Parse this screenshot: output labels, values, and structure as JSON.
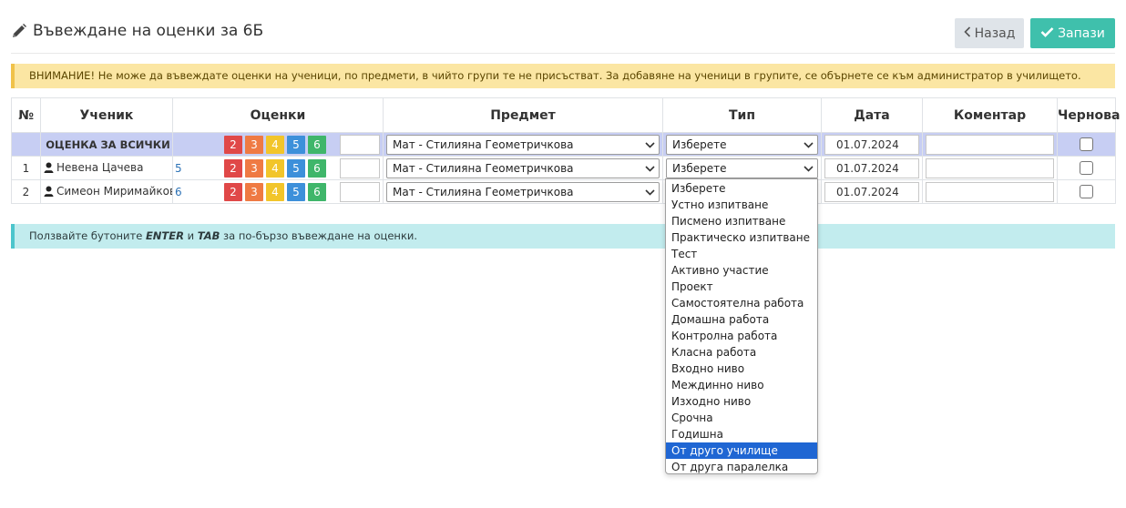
{
  "header": {
    "title": "Въвеждане на оценки за 6Б",
    "back_label": "Назад",
    "save_label": "Запази"
  },
  "warning": "ВНИМАНИЕ! Не може да въвеждате оценки на ученици, по предмети, в чийто групи те не присъстват. За добавяне на ученици в групите, се обърнете се към администратор в училището.",
  "table": {
    "headers": [
      "№",
      "Ученик",
      "Оценки",
      "Предмет",
      "Тип",
      "Дата",
      "Коментар",
      "Чернова"
    ],
    "grade_buttons": [
      "2",
      "3",
      "4",
      "5",
      "6"
    ],
    "rows": [
      {
        "no": "",
        "student": "ОЦЕНКА ЗА ВСИЧКИ",
        "existing_grade": "",
        "subject": "Мат - Стилияна Геометричкова",
        "type": "Изберете",
        "date": "01.07.2024",
        "comment": ""
      },
      {
        "no": "1",
        "student": "Невена Цачева",
        "existing_grade": "5",
        "subject": "Мат - Стилияна Геометричкова",
        "type": "Изберете",
        "date": "01.07.2024",
        "comment": ""
      },
      {
        "no": "2",
        "student": "Симеон Миримайков",
        "existing_grade": "6",
        "subject": "Мат - Стилияна Геометричкова",
        "type": "",
        "date": "01.07.2024",
        "comment": ""
      }
    ]
  },
  "type_dropdown": {
    "options": [
      "Изберете",
      "Устно изпитване",
      "Писмено изпитване",
      "Практическо изпитване",
      "Тест",
      "Активно участие",
      "Проект",
      "Самостоятелна работа",
      "Домашна работа",
      "Контролна работа",
      "Класна работа",
      "Входно ниво",
      "Междинно ниво",
      "Изходно ниво",
      "Срочна",
      "Годишна",
      "От друго училище",
      "От друга паралелка"
    ],
    "highlighted": "От друго училище"
  },
  "hint": {
    "prefix": "Ползвайте бутоните ",
    "key1": "ENTER",
    "mid": " и ",
    "key2": "TAB",
    "suffix": " за по-бързо въвеждане на оценки."
  },
  "colors": {
    "grade_2": "#e04848",
    "grade_3": "#ef7a43",
    "grade_4": "#f2c52a",
    "grade_5": "#3d90da",
    "grade_6": "#3fb66a",
    "save_button": "#3fc0ac",
    "all_row": "#c7cef3",
    "selected_option": "#1f66d3"
  }
}
